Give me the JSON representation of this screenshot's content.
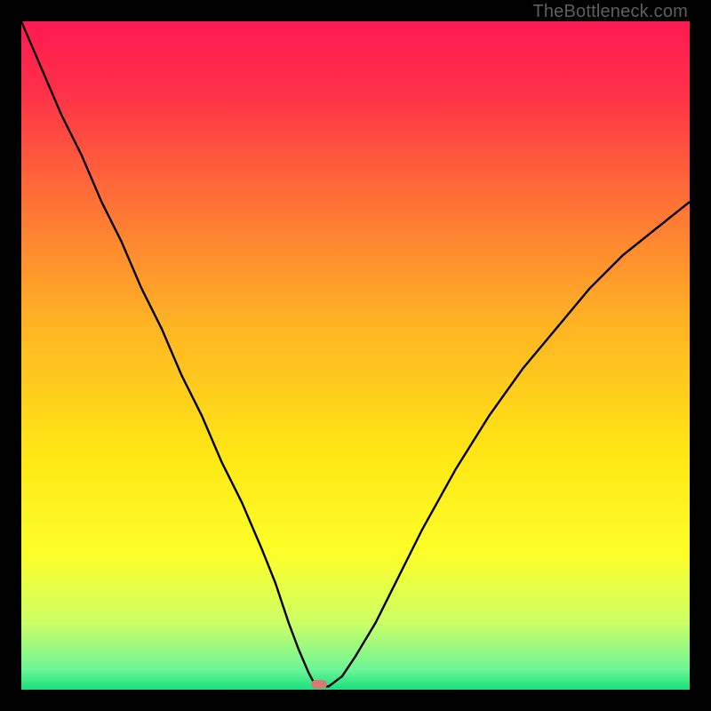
{
  "watermark": "TheBottleneck.com",
  "chart_data": {
    "type": "line",
    "title": "",
    "xlabel": "",
    "ylabel": "",
    "xlim": [
      0,
      100
    ],
    "ylim": [
      0,
      100
    ],
    "grid": false,
    "background_gradient": {
      "stops": [
        {
          "pos": 0.0,
          "color": "#ff1a52"
        },
        {
          "pos": 0.1,
          "color": "#ff2e49"
        },
        {
          "pos": 0.25,
          "color": "#ff6a38"
        },
        {
          "pos": 0.45,
          "color": "#ffb324"
        },
        {
          "pos": 0.65,
          "color": "#ffe714"
        },
        {
          "pos": 0.8,
          "color": "#fbff2a"
        },
        {
          "pos": 0.9,
          "color": "#ccff66"
        },
        {
          "pos": 0.97,
          "color": "#6cf596"
        },
        {
          "pos": 1.0,
          "color": "#18e07e"
        }
      ]
    },
    "series": [
      {
        "name": "bottleneck-curve",
        "color": "#000000",
        "x": [
          0,
          3,
          6,
          9,
          12,
          15,
          18,
          21,
          24,
          27,
          30,
          33,
          36,
          38,
          40,
          41.5,
          43,
          43.8,
          44.5,
          46,
          48,
          50,
          53,
          56,
          60,
          65,
          70,
          75,
          80,
          85,
          90,
          95,
          100
        ],
        "y": [
          100,
          93,
          86,
          80,
          73,
          67,
          60,
          54,
          47,
          41,
          34,
          28,
          21,
          16,
          10,
          6,
          2.5,
          1,
          0.5,
          0.5,
          2,
          5,
          10,
          16,
          24,
          33,
          41,
          48,
          54,
          60,
          65,
          69,
          73
        ]
      }
    ],
    "marker": {
      "name": "optimal-point",
      "x": 44.5,
      "y": 0.8,
      "color": "#d97a74"
    }
  }
}
